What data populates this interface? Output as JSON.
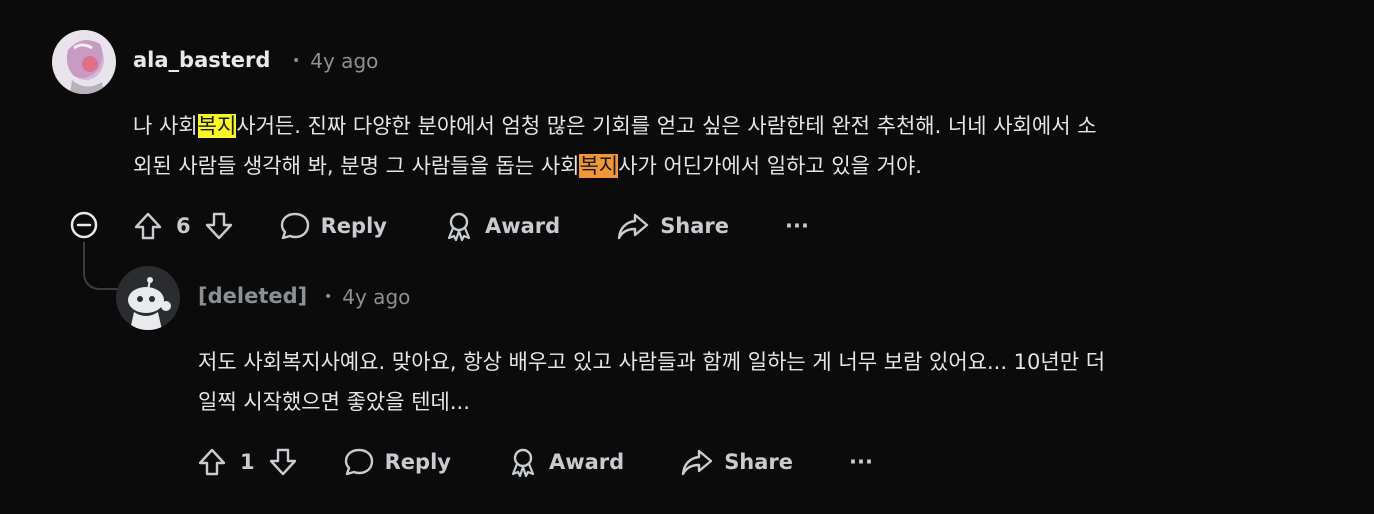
{
  "comment1": {
    "username": "ala_basterd",
    "time": "4y ago",
    "body": {
      "p1": "나 사회",
      "h1": "복지",
      "p2": "사거든. 진짜 다양한 분야에서 엄청 많은 기회를 얻고 싶은 사람한테 완전 추천해. 너네 사회에서 소",
      "p3": "외된 사람들 생각해 봐, 분명 그 사람들을 돕는 사회",
      "h2": "복지",
      "p4": "사가 어딘가에서 일하고 있을 거야."
    },
    "votes": "6",
    "reply": "Reply",
    "award": "Award",
    "share": "Share",
    "more": "···"
  },
  "comment2": {
    "username": "[deleted]",
    "time": "4y ago",
    "body": {
      "line1": "저도 사회복지사예요. 맞아요, 항상 배우고 있고 사람들과 함께 일하는 게 너무 보람 있어요... 10년만 더",
      "line2": "일찍 시작했으면 좋았을 텐데..."
    },
    "votes": "1",
    "reply": "Reply",
    "award": "Award",
    "share": "Share",
    "more": "···"
  },
  "colors": {
    "background": "#0b0b0c",
    "highlight_yellow": "#f7f72a",
    "highlight_orange": "#f2963a"
  }
}
